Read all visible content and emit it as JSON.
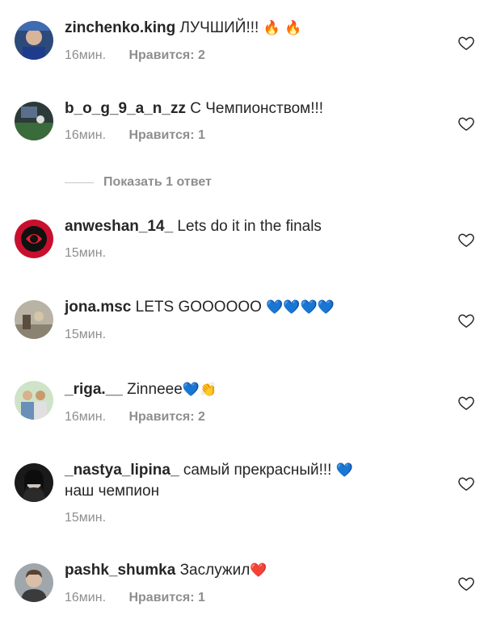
{
  "colors": {
    "text": "#262626",
    "secondary": "#8e8e8e",
    "fire": "#f07a1a",
    "blue_heart": "#1877f2",
    "red_heart": "#e0142b"
  },
  "comments": [
    {
      "username": "zinchenko.king",
      "text": "ЛУЧШИЙ!!!",
      "emoji": "🔥 🔥",
      "time": "16мин.",
      "likes": "Нравится: 2"
    },
    {
      "username": "b_o_g_9_a_n_zz",
      "text": "С Чемпионством!!!",
      "time": "16мин.",
      "likes": "Нравится: 1"
    },
    {
      "username": "anweshan_14_",
      "text": "Lets do it in the finals",
      "time": "15мин."
    },
    {
      "username": "jona.msc",
      "text": "LETS GOOOOOO",
      "emoji": "💙💙💙💙",
      "time": "15мин."
    },
    {
      "username": "_riga.__",
      "text": "Zinneee",
      "emoji": "💙👏",
      "time": "16мин.",
      "likes": "Нравится: 2"
    },
    {
      "username": "_nastya_lipina_",
      "text": "самый прекрасный!!!",
      "emoji": "💙",
      "text2": "наш чемпион",
      "time": "15мин."
    },
    {
      "username": "pashk_shumka",
      "text": "Заслужил",
      "emoji": "❤️",
      "time": "16мин.",
      "likes": "Нравится: 1"
    }
  ],
  "replies_toggle": "Показать 1 ответ",
  "icons": {
    "like": "heart-outline-icon"
  }
}
